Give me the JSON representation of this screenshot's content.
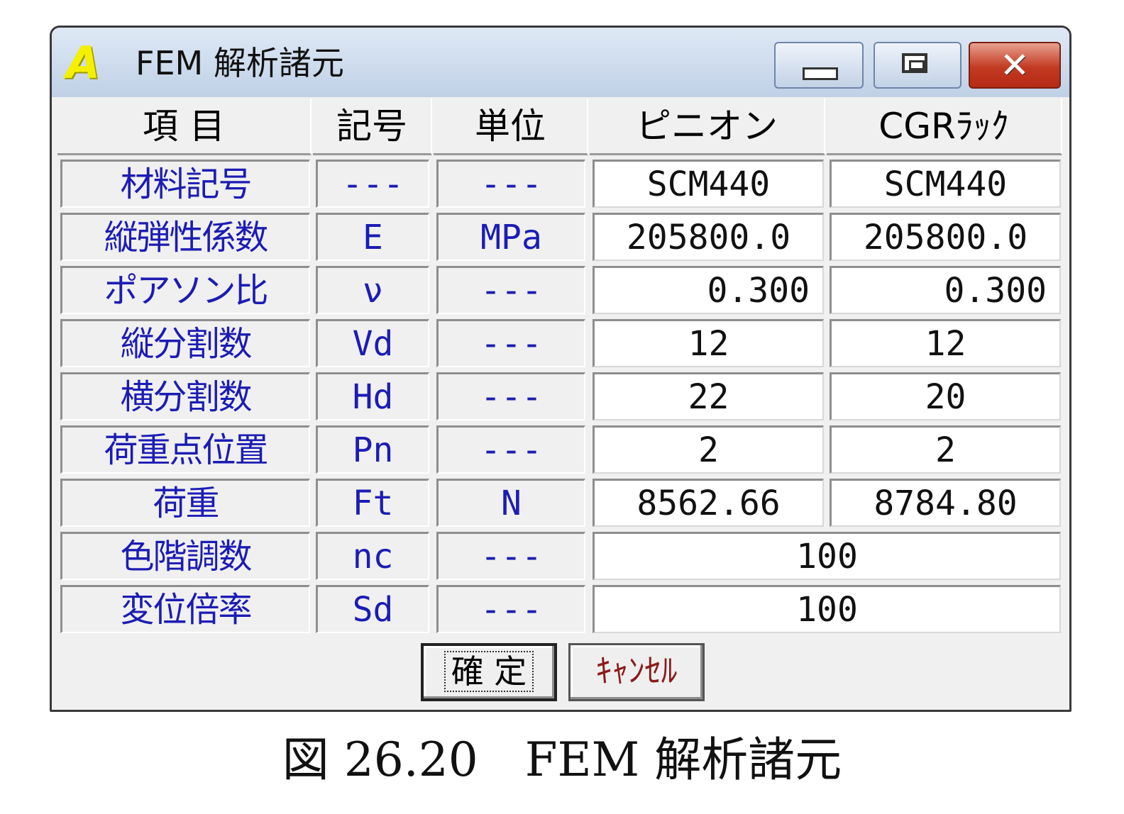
{
  "window": {
    "title": "FEM 解析諸元",
    "app_icon_letter": "A",
    "minimize_label": "",
    "maximize_label": "",
    "close_label": "✕"
  },
  "table": {
    "headers": [
      "項 目",
      "記号",
      "単位",
      "ピニオン",
      "CGRﾗｯｸ"
    ],
    "rows": [
      {
        "item": "材料記号",
        "symbol": "---",
        "unit": "---",
        "pinion": "SCM440",
        "rack": "SCM440"
      },
      {
        "item": "縦弾性係数",
        "symbol": "E",
        "unit": "MPa",
        "pinion": "205800.0",
        "rack": "205800.0"
      },
      {
        "item": "ポアソン比",
        "symbol": "ν",
        "unit": "---",
        "pinion": "0.300",
        "rack": "0.300"
      },
      {
        "item": "縦分割数",
        "symbol": "Vd",
        "unit": "---",
        "pinion": "12",
        "rack": "12"
      },
      {
        "item": "横分割数",
        "symbol": "Hd",
        "unit": "---",
        "pinion": "22",
        "rack": "20"
      },
      {
        "item": "荷重点位置",
        "symbol": "Pn",
        "unit": "---",
        "pinion": "2",
        "rack": "2"
      },
      {
        "item": "荷重",
        "symbol": "Ft",
        "unit": "N",
        "pinion": "8562.66",
        "rack": "8784.80"
      },
      {
        "item": "色階調数",
        "symbol": "nc",
        "unit": "---",
        "value": "100"
      },
      {
        "item": "変位倍率",
        "symbol": "Sd",
        "unit": "---",
        "value": "100"
      }
    ]
  },
  "buttons": {
    "ok_label": "確 定",
    "cancel_label": "ｷｬﾝｾﾙ"
  },
  "caption": "図 26.20　FEM 解析諸元",
  "colors": {
    "label_blue": "#1c1cb4",
    "cancel_red": "#8b1a1a",
    "icon_yellow": "#f5f000"
  }
}
